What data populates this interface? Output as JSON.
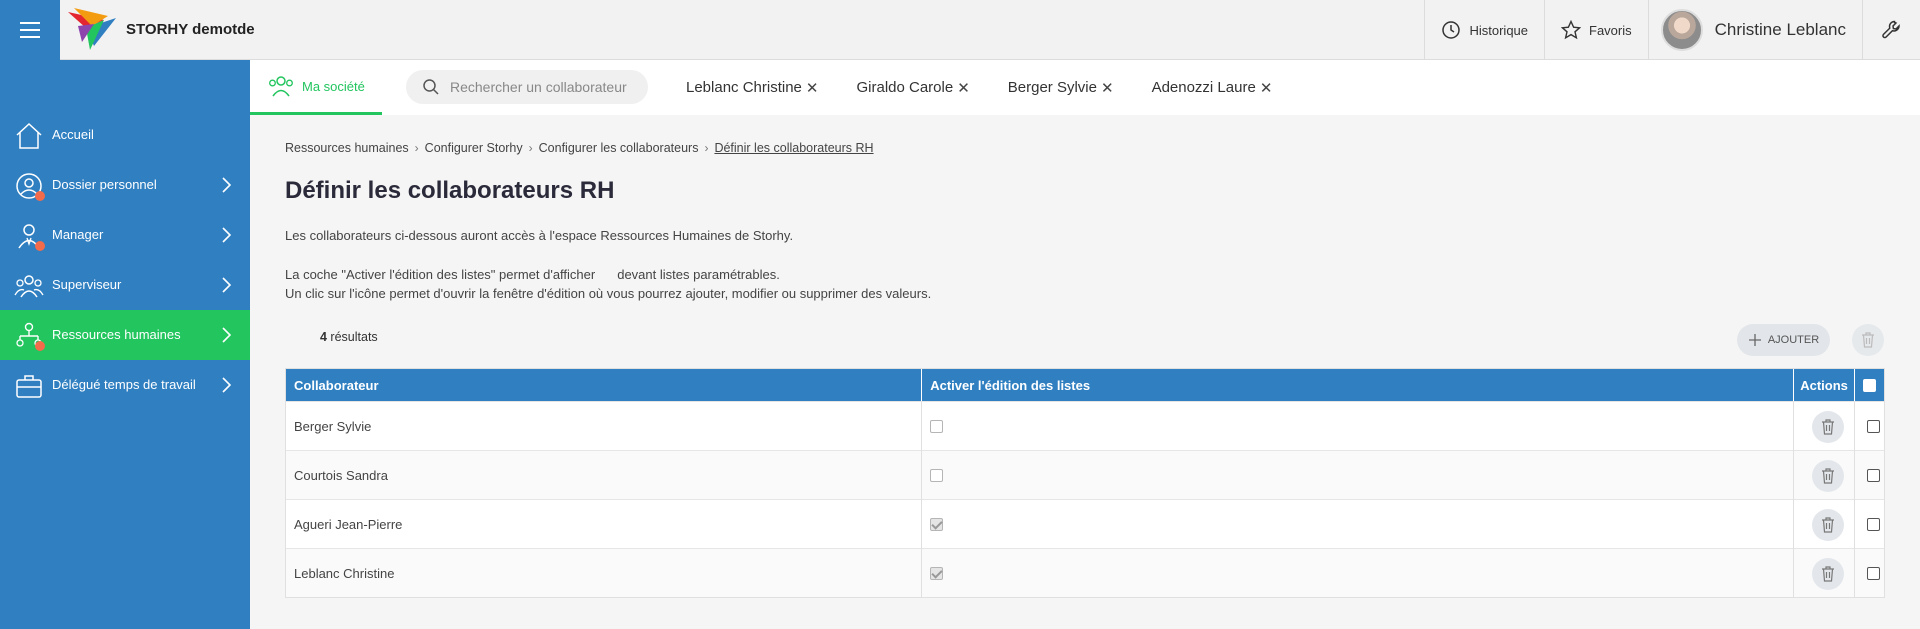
{
  "app": {
    "name": "STORHY demotde"
  },
  "topbar": {
    "historique_label": "Historique",
    "favoris_label": "Favoris",
    "user_name": "Christine Leblanc"
  },
  "sidebar": {
    "items": [
      {
        "label": "Accueil"
      },
      {
        "label": "Dossier personnel"
      },
      {
        "label": "Manager"
      },
      {
        "label": "Superviseur"
      },
      {
        "label": "Ressources humaines"
      },
      {
        "label": "Délégué temps de travail"
      }
    ]
  },
  "tabbar": {
    "societe_label": "Ma société",
    "search_placeholder": "Rechercher un collaborateur",
    "chips": [
      {
        "label": "Leblanc Christine"
      },
      {
        "label": "Giraldo Carole"
      },
      {
        "label": "Berger Sylvie"
      },
      {
        "label": "Adenozzi Laure"
      }
    ]
  },
  "breadcrumb": {
    "items": [
      "Ressources humaines",
      "Configurer Storhy",
      "Configurer les collaborateurs",
      "Définir les collaborateurs RH"
    ]
  },
  "page": {
    "title": "Définir les collaborateurs RH",
    "desc1": "Les collaborateurs ci-dessous auront accès à l'espace Ressources Humaines de Storhy.",
    "desc2a": "La coche \"Activer l'édition des listes\" permet d'afficher",
    "desc2b": "devant listes paramétrables.",
    "desc3": "Un clic sur l'icône permet d'ouvrir la fenêtre d'édition où vous pourrez ajouter, modifier ou supprimer des valeurs.",
    "results_count": "4",
    "results_label": " résultats",
    "add_label": "AJOUTER"
  },
  "table": {
    "headers": {
      "collaborateur": "Collaborateur",
      "edition": "Activer l'édition des listes",
      "actions": "Actions"
    },
    "rows": [
      {
        "name": "Berger Sylvie",
        "edition_checked": false
      },
      {
        "name": "Courtois Sandra",
        "edition_checked": false
      },
      {
        "name": "Agueri Jean-Pierre",
        "edition_checked": true
      },
      {
        "name": "Leblanc Christine",
        "edition_checked": true
      }
    ]
  },
  "colors": {
    "primary_blue": "#2f7fc1",
    "active_green": "#22c55e",
    "notification_dot": "#f26b4b"
  }
}
